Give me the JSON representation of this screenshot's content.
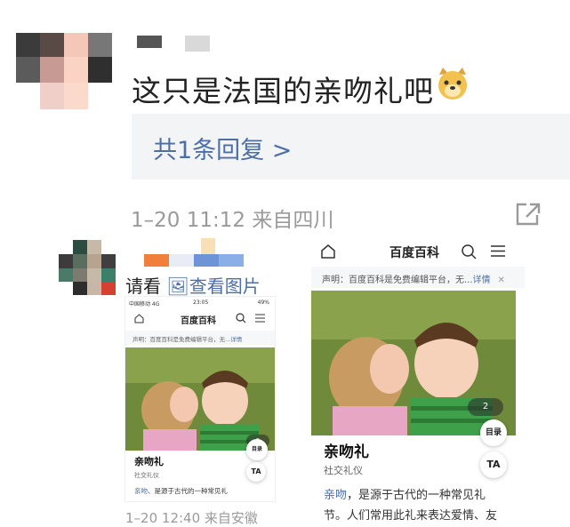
{
  "comment": {
    "text": "这只是法国的亲吻礼吧",
    "emoji_icon": "doge-emoji-icon",
    "reply_link": "共1条回复 >",
    "time": "1–20 11:12",
    "location": "来自四川",
    "share_icon": "share-icon"
  },
  "reply_comment": {
    "prefix": "请看",
    "view_image_link": "查看图片",
    "time": "1–20 12:40",
    "location": "来自安徽"
  },
  "baike_small": {
    "status_left": "中国移动 4G",
    "status_time": "23:05",
    "status_battery": "49%",
    "brand": "百度百科",
    "notice": "声明：百度百科是免费编辑平台，无...",
    "notice_link": "详情",
    "catalog_label": "目录",
    "gallery_count": "2",
    "ta_label": "TA",
    "title": "亲吻礼",
    "subtitle": "社交礼仪",
    "desc_link": "亲吻",
    "desc_rest": "、是源于古代的一种常见礼"
  },
  "baike_large": {
    "brand": "百度百科",
    "notice": "声明：百度百科是免费编辑平台，无...",
    "notice_link": "详情",
    "catalog_label": "目录",
    "gallery_count": "2",
    "ta_label": "TA",
    "title": "亲吻礼",
    "subtitle": "社交礼仪",
    "desc_link": "亲吻",
    "desc_line1_rest": "，是源于古代的一种常见礼",
    "desc_line2": "节。人们常用此礼来表达爱情、友"
  },
  "colors": {
    "link": "#4d6fa8",
    "meta": "#9a9a9a",
    "reply_bg": "#f3f4f6"
  }
}
